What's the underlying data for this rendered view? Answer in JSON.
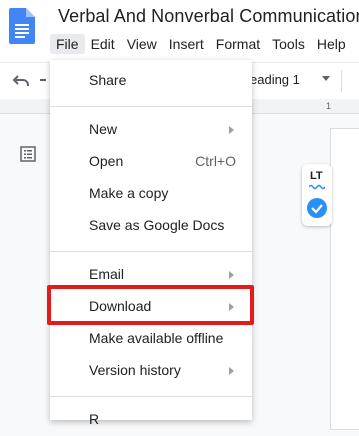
{
  "document": {
    "title": "Verbal And Nonverbal Communication"
  },
  "menubar": {
    "items": [
      "File",
      "Edit",
      "View",
      "Insert",
      "Format",
      "Tools",
      "Help"
    ]
  },
  "toolbar": {
    "style_value": "eading 1",
    "ruler_number": "1"
  },
  "lt_widget": {
    "logo_text": "LT"
  },
  "file_menu": {
    "items": [
      {
        "label": "Share"
      },
      {
        "label": "New"
      },
      {
        "label": "Open",
        "shortcut": "Ctrl+O"
      },
      {
        "label": "Make a copy"
      },
      {
        "label": "Save as Google Docs"
      },
      {
        "label": "Email"
      },
      {
        "label": "Download"
      },
      {
        "label": "Make available offline"
      },
      {
        "label": "Version history"
      },
      {
        "label": "R"
      }
    ]
  },
  "colors": {
    "highlight": "#e31b1b",
    "docs_blue": "#4285f4",
    "check_blue": "#2b90f4"
  }
}
